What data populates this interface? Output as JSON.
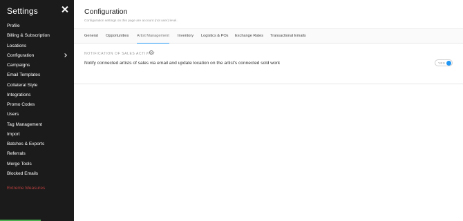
{
  "sidebar": {
    "title": "Settings",
    "items": [
      {
        "label": "Profile"
      },
      {
        "label": "Billing & Subscription"
      },
      {
        "label": "Locations"
      },
      {
        "label": "Configuration"
      },
      {
        "label": "Campaigns"
      },
      {
        "label": "Email Templates"
      },
      {
        "label": "Collateral Style"
      },
      {
        "label": "Integrations"
      },
      {
        "label": "Promo Codes"
      },
      {
        "label": "Users"
      },
      {
        "label": "Tag Management"
      },
      {
        "label": "Import"
      },
      {
        "label": "Batches & Exports"
      },
      {
        "label": "Referrals"
      },
      {
        "label": "Merge Tools"
      },
      {
        "label": "Blocked Emails"
      }
    ],
    "danger_label": "Extreme Measures"
  },
  "main": {
    "title": "Configuration",
    "subtitle": "Configuration settings on this page are account (not user) level.",
    "tabs": [
      {
        "label": "General"
      },
      {
        "label": "Opportunities"
      },
      {
        "label": "Artist Management"
      },
      {
        "label": "Inventory"
      },
      {
        "label": "Logistics & POs"
      },
      {
        "label": "Exchange Rates"
      },
      {
        "label": "Transactional Emails"
      }
    ],
    "active_tab": "Artist Management",
    "section": {
      "heading": "NOTIFICATION OF SALES ACTIVITY",
      "help_icon_glyph": "?",
      "setting_label": "Notify connected artists of sales via email and update location on the artist's connected sold work",
      "toggle_label": "YES",
      "toggle_on": true
    }
  },
  "colors": {
    "sidebar_bg": "#1b1b1b",
    "accent": "#2196f3",
    "danger": "#b43d3d",
    "progress": "#4caf50"
  },
  "icons": {
    "close": "close-icon",
    "chevron": "chevron-right-icon",
    "help": "question-circle-icon"
  }
}
